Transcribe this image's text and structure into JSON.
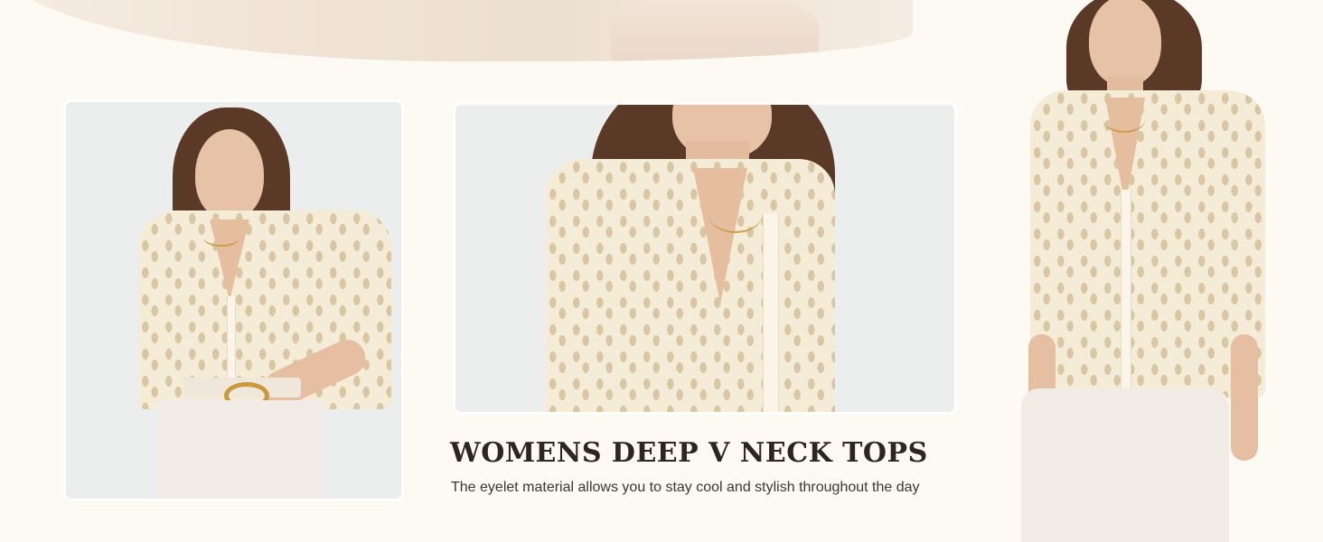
{
  "product": {
    "heading": "WOMENS DEEP V NECK TOPS",
    "description": "The eyelet material allows you to stay cool and stylish throughout the day"
  },
  "images": [
    {
      "name": "photo-left",
      "subject": "model-front-view"
    },
    {
      "name": "photo-middle",
      "subject": "neckline-closeup"
    },
    {
      "name": "photo-right",
      "subject": "model-full-view"
    }
  ],
  "colors": {
    "background": "#fdf9f3",
    "blouse": "#f4ecd6",
    "heading": "#2c2620",
    "accent_gold": "#c99a3c"
  }
}
